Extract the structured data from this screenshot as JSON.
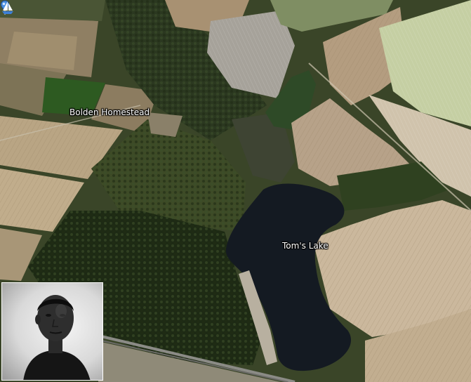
{
  "map": {
    "view": "satellite",
    "placemarks": [
      {
        "label": "Bolden Homestead",
        "icon": "pushpin-icon",
        "color": "#4a8fe0"
      },
      {
        "label": "Tom's Lake",
        "icon": "sailboat-icon",
        "color": "#ffffff"
      }
    ]
  },
  "portrait": {
    "style": "black-and-white",
    "subject": "man-portrait"
  },
  "colors": {
    "field_tan": "#b8a07f",
    "forest": "#2f3d1f",
    "lake": "#141a22",
    "pond": "#2d4a25",
    "label_text": "#ffffff"
  }
}
